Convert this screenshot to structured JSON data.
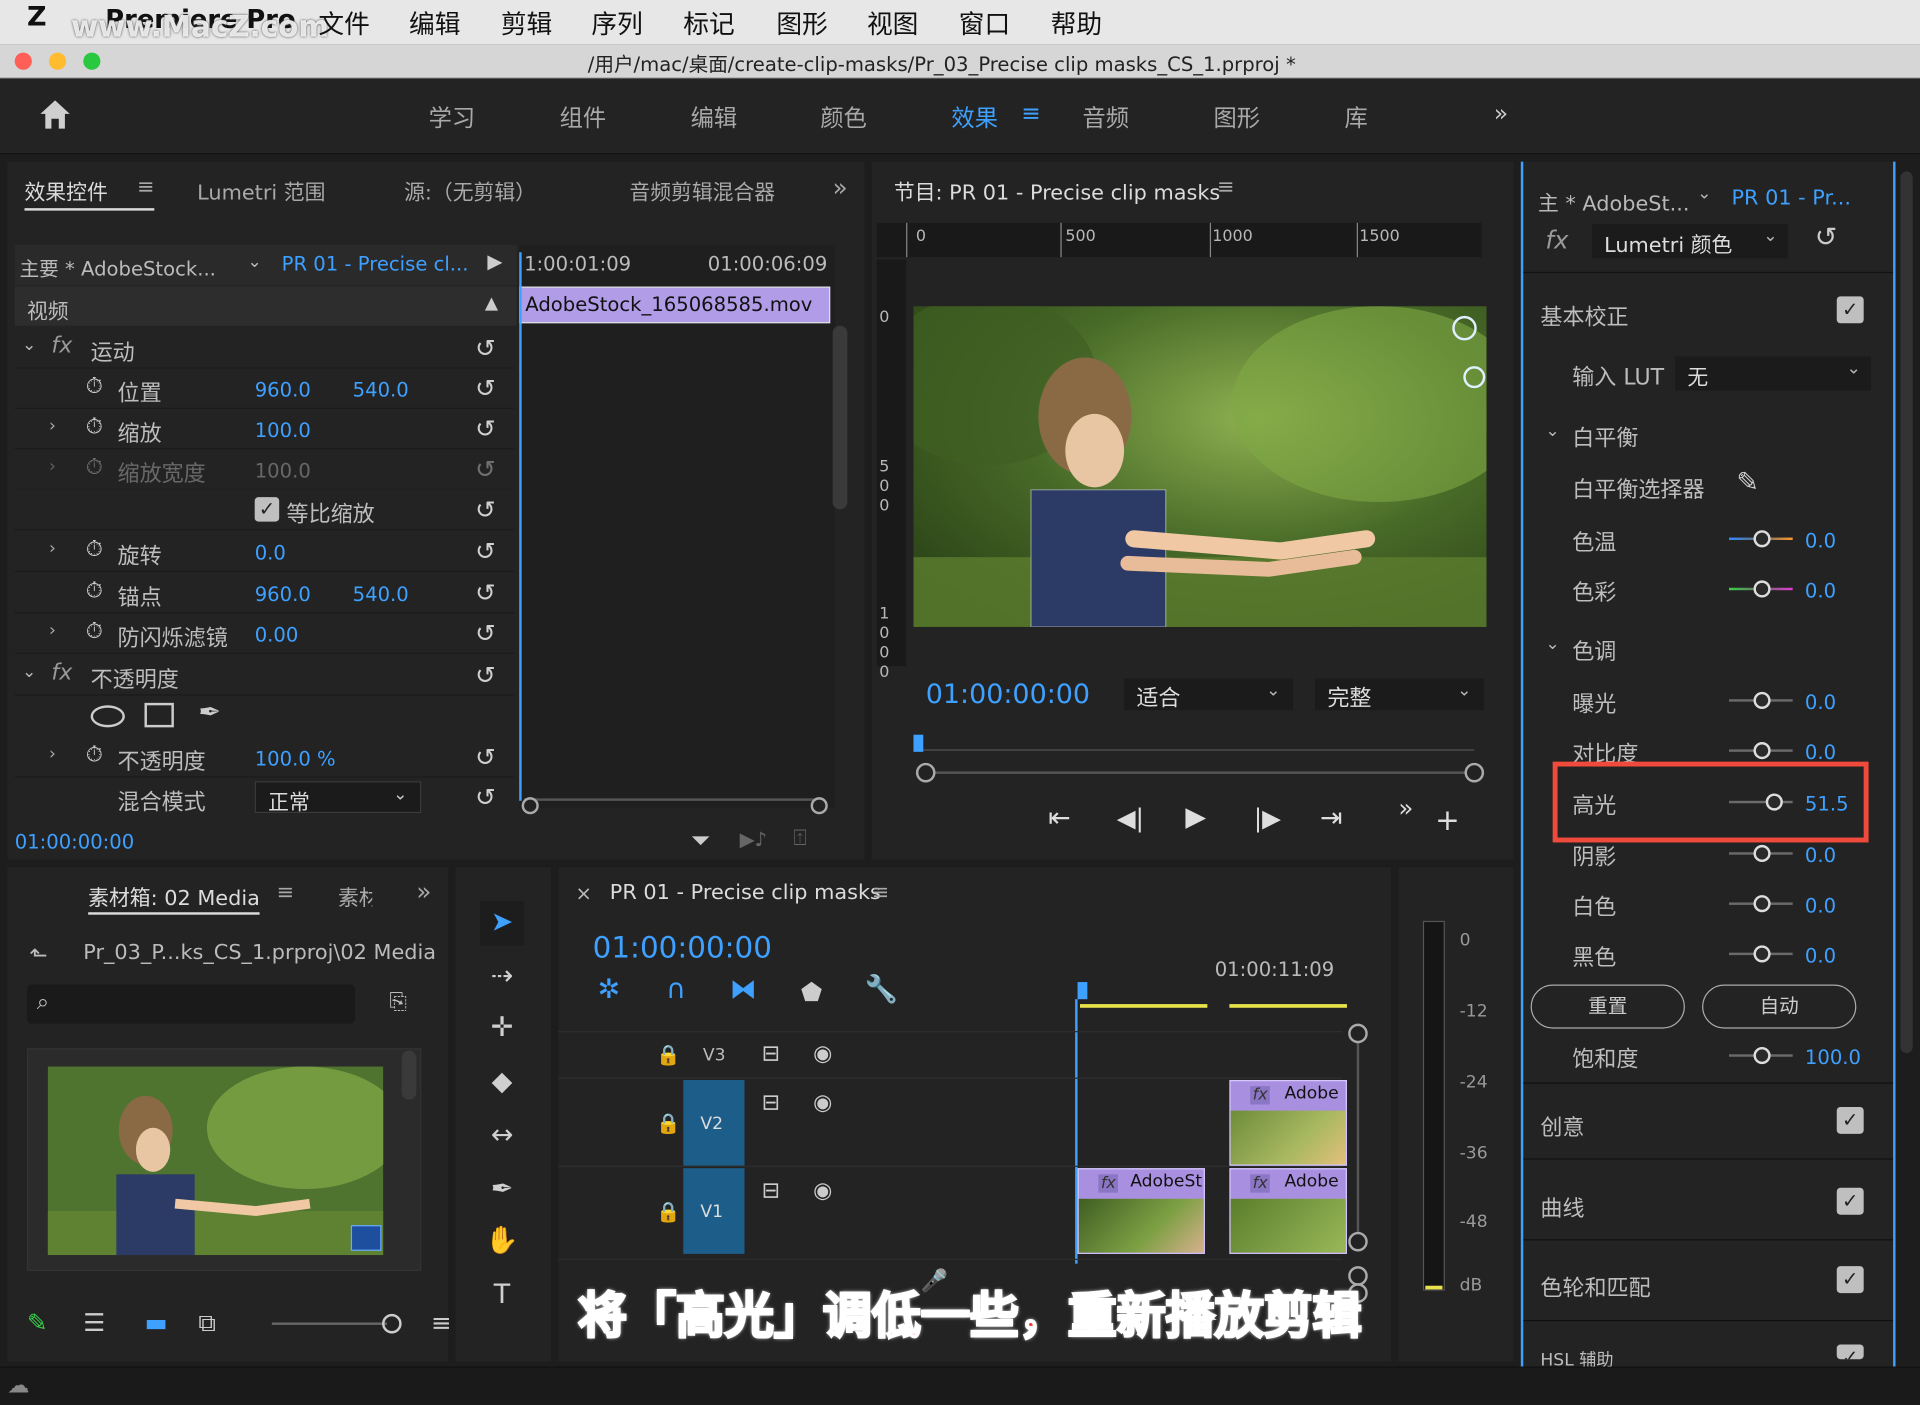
{
  "menubar": {
    "app": "Premiere Pro",
    "watermark": "www.MacZ.com",
    "items": [
      "文件",
      "编辑",
      "剪辑",
      "序列",
      "标记",
      "图形",
      "视图",
      "窗口",
      "帮助"
    ]
  },
  "titlebar": {
    "path": "/用户/mac/桌面/create-clip-masks/Pr_03_Precise clip masks_CS_1.prproj *"
  },
  "workspaces": {
    "tabs": [
      "学习",
      "组件",
      "编辑",
      "颜色",
      "效果",
      "音频",
      "图形",
      "库"
    ],
    "active": "效果"
  },
  "effect_controls": {
    "tabs": [
      "效果控件",
      "Lumetri 范围",
      "源:（无剪辑）",
      "音频剪辑混合器"
    ],
    "master": "主要 * AdobeStock...",
    "sequence": "PR 01 - Precise cl...",
    "tc_start": "1:00:01:09",
    "tc_end": "01:00:06:09",
    "clip_name": "AdobeStock_165068585.mov",
    "video_label": "视频",
    "motion": "运动",
    "position": "位置",
    "pos_x": "960.0",
    "pos_y": "540.0",
    "scale": "缩放",
    "scale_v": "100.0",
    "scale_width": "缩放宽度",
    "scale_width_v": "100.0",
    "uniform": "等比缩放",
    "rotation": "旋转",
    "rotation_v": "0.0",
    "anchor": "锚点",
    "anchor_x": "960.0",
    "anchor_y": "540.0",
    "flicker": "防闪烁滤镜",
    "flicker_v": "0.00",
    "opacity_group": "不透明度",
    "opacity": "不透明度",
    "opacity_v": "100.0 %",
    "blend": "混合模式",
    "blend_v": "正常",
    "timecode": "01:00:00:00"
  },
  "program": {
    "title": "节目: PR 01 - Precise clip masks",
    "ruler": [
      "0",
      "500",
      "1000",
      "1500"
    ],
    "vruler_0": "0",
    "vruler_500": "5\n0\n0",
    "vruler_1000": "1\n0\n0\n0",
    "timecode": "01:00:00:00",
    "fit": "适合",
    "quality": "完整"
  },
  "lumetri": {
    "master": "主 * AdobeSt...",
    "sequence": "PR 01 - Pr...",
    "effect": "Lumetri 颜色",
    "basic": "基本校正",
    "input_lut": "输入 LUT",
    "lut_v": "无",
    "wb": "白平衡",
    "wb_picker": "白平衡选择器",
    "temp": "色温",
    "temp_v": "0.0",
    "tint": "色彩",
    "tint_v": "0.0",
    "tone": "色调",
    "exposure": "曝光",
    "exposure_v": "0.0",
    "contrast": "对比度",
    "contrast_v": "0.0",
    "highlights": "高光",
    "highlights_v": "51.5",
    "shadows": "阴影",
    "shadows_v": "0.0",
    "whites": "白色",
    "whites_v": "0.0",
    "blacks": "黑色",
    "blacks_v": "0.0",
    "reset": "重置",
    "auto": "自动",
    "saturation": "饱和度",
    "saturation_v": "100.0",
    "creative": "创意",
    "curves": "曲线",
    "wheels": "色轮和匹配",
    "hsl": "HSL 辅助"
  },
  "project": {
    "tab": "素材箱: 02 Media",
    "tab2": "素材",
    "path": "Pr_03_P...ks_CS_1.prproj\\02 Media"
  },
  "timeline": {
    "title": "PR 01 - Precise clip masks",
    "timecode": "01:00:00:00",
    "ruler_tc": "01:00:11:09",
    "tracks": [
      "V3",
      "V2",
      "V1"
    ],
    "clip_v1": "AdobeSt",
    "clip_v2": "Adobe",
    "clip_v1b": "Adobe"
  },
  "meter": {
    "labels": [
      "0",
      "-12",
      "-24",
      "-36",
      "-48",
      "dB"
    ]
  },
  "caption": "将「高光」调低一些，重新播放剪辑",
  "colors": {
    "accent": "#3ea0ff",
    "highlight_box": "#f04a3c",
    "clip": "#a98fe0",
    "caption": "#e8372c"
  }
}
